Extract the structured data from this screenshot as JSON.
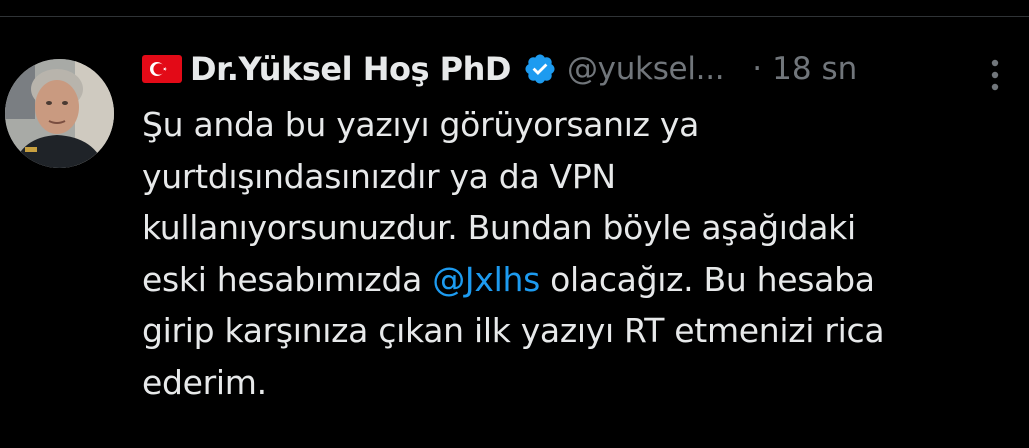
{
  "tweet": {
    "author": {
      "flag": "🇹🇷",
      "display_name": "Dr.Yüksel Hoş PhD",
      "handle": "@yuksel...",
      "verified": true
    },
    "separator": "·",
    "timestamp": "18 sn",
    "body_lines": {
      "l1": "Şu anda bu yazıyı görüyorsanız ya",
      "l2": "yurtdışındasınızdır ya da VPN",
      "l3": "kullanıyorsunuzdur. Bundan böyle aşağıdaki",
      "l4_before": "eski hesabımızda ",
      "l4_mention": "@Jxlhs",
      "l4_after": " olacağız. Bu hesaba",
      "l5": "girip karşınıza çıkan ilk yazıyı RT etmenizi rica",
      "l6": "ederim."
    }
  },
  "colors": {
    "background": "#000000",
    "text": "#e7e9ea",
    "secondary_text": "#71767b",
    "link": "#1d9bf0",
    "verified_badge": "#1d9bf0"
  },
  "icons": {
    "flag": "turkey-flag-icon",
    "verified": "verified-badge-icon",
    "more": "more-options-icon"
  }
}
